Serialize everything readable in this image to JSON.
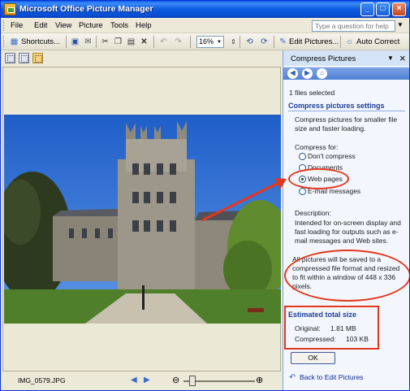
{
  "window": {
    "title": "Microsoft Office Picture Manager",
    "controls": [
      "_",
      "□",
      "×"
    ]
  },
  "menubar": {
    "items": [
      "File",
      "Edit",
      "View",
      "Picture",
      "Tools",
      "Help"
    ],
    "help_placeholder": "Type a question for help"
  },
  "toolbar": {
    "shortcuts_label": "Shortcuts...",
    "zoom_value": "16%",
    "edit_pictures_label": "Edit Pictures...",
    "auto_correct_label": "Auto Correct"
  },
  "statusbar": {
    "filename": "IMG_0579.JPG"
  },
  "task_pane": {
    "title": "Compress Pictures",
    "selection_status": "1 files selected",
    "settings_heading": "Compress pictures settings",
    "intro_text": "Compress pictures for smaller file size and faster loading.",
    "compress_for_label": "Compress for:",
    "options": [
      {
        "label": "Don't compress",
        "selected": false
      },
      {
        "label": "Documents",
        "selected": false
      },
      {
        "label": "Web pages",
        "selected": true
      },
      {
        "label": "E-mail messages",
        "selected": false
      }
    ],
    "description_label": "Description:",
    "description_text": "Intended for on-screen display and fast loading for outputs such as e-mail messages and Web sites.",
    "resize_note": "All pictures will be saved to a compressed file format and resized to fit within a window of 448 x 336 pixels.",
    "estimate_heading": "Estimated total size",
    "original_label": "Original:",
    "original_value": "1.81 MB",
    "compressed_label": "Compressed:",
    "compressed_value": "103 KB",
    "ok_label": "OK",
    "back_link": "Back to Edit Pictures"
  },
  "annotation_color": "#e3371f"
}
